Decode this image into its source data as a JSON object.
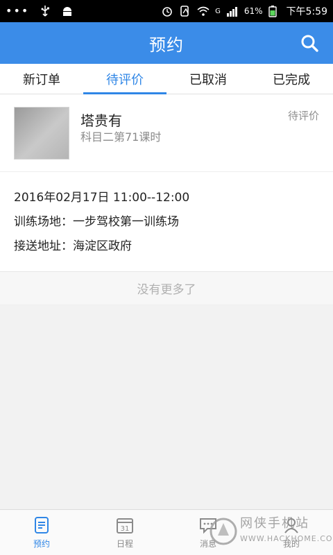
{
  "status_bar": {
    "dots": "•••",
    "signal_label": "G",
    "battery_percent": "61%",
    "time": "下午5:59"
  },
  "header": {
    "title": "预约"
  },
  "tabs": [
    {
      "label": "新订单",
      "active": false
    },
    {
      "label": "待评价",
      "active": true
    },
    {
      "label": "已取消",
      "active": false
    },
    {
      "label": "已完成",
      "active": false
    }
  ],
  "order": {
    "name": "塔贵有",
    "course": "科目二第71课时",
    "status": "待评价",
    "datetime": "2016年02月17日 11:00--12:00",
    "venue": "训练场地：一步驾校第一训练场",
    "pickup": "接送地址：海淀区政府"
  },
  "list_footer": "没有更多了",
  "bottom_nav": [
    {
      "label": "预约",
      "icon": "calendar-list-icon",
      "active": true
    },
    {
      "label": "日程",
      "icon": "schedule-icon",
      "active": false
    },
    {
      "label": "消息",
      "icon": "message-icon",
      "active": false
    },
    {
      "label": "我的",
      "icon": "profile-icon",
      "active": false
    }
  ],
  "watermark": {
    "cn": "网侠手机站",
    "en": "WWW.HACKHOME.COM"
  },
  "colors": {
    "header_bg": "#3b8ce8",
    "accent": "#2f86e6",
    "status_bar_bg": "#000000",
    "page_bg": "#f2f2f2"
  }
}
